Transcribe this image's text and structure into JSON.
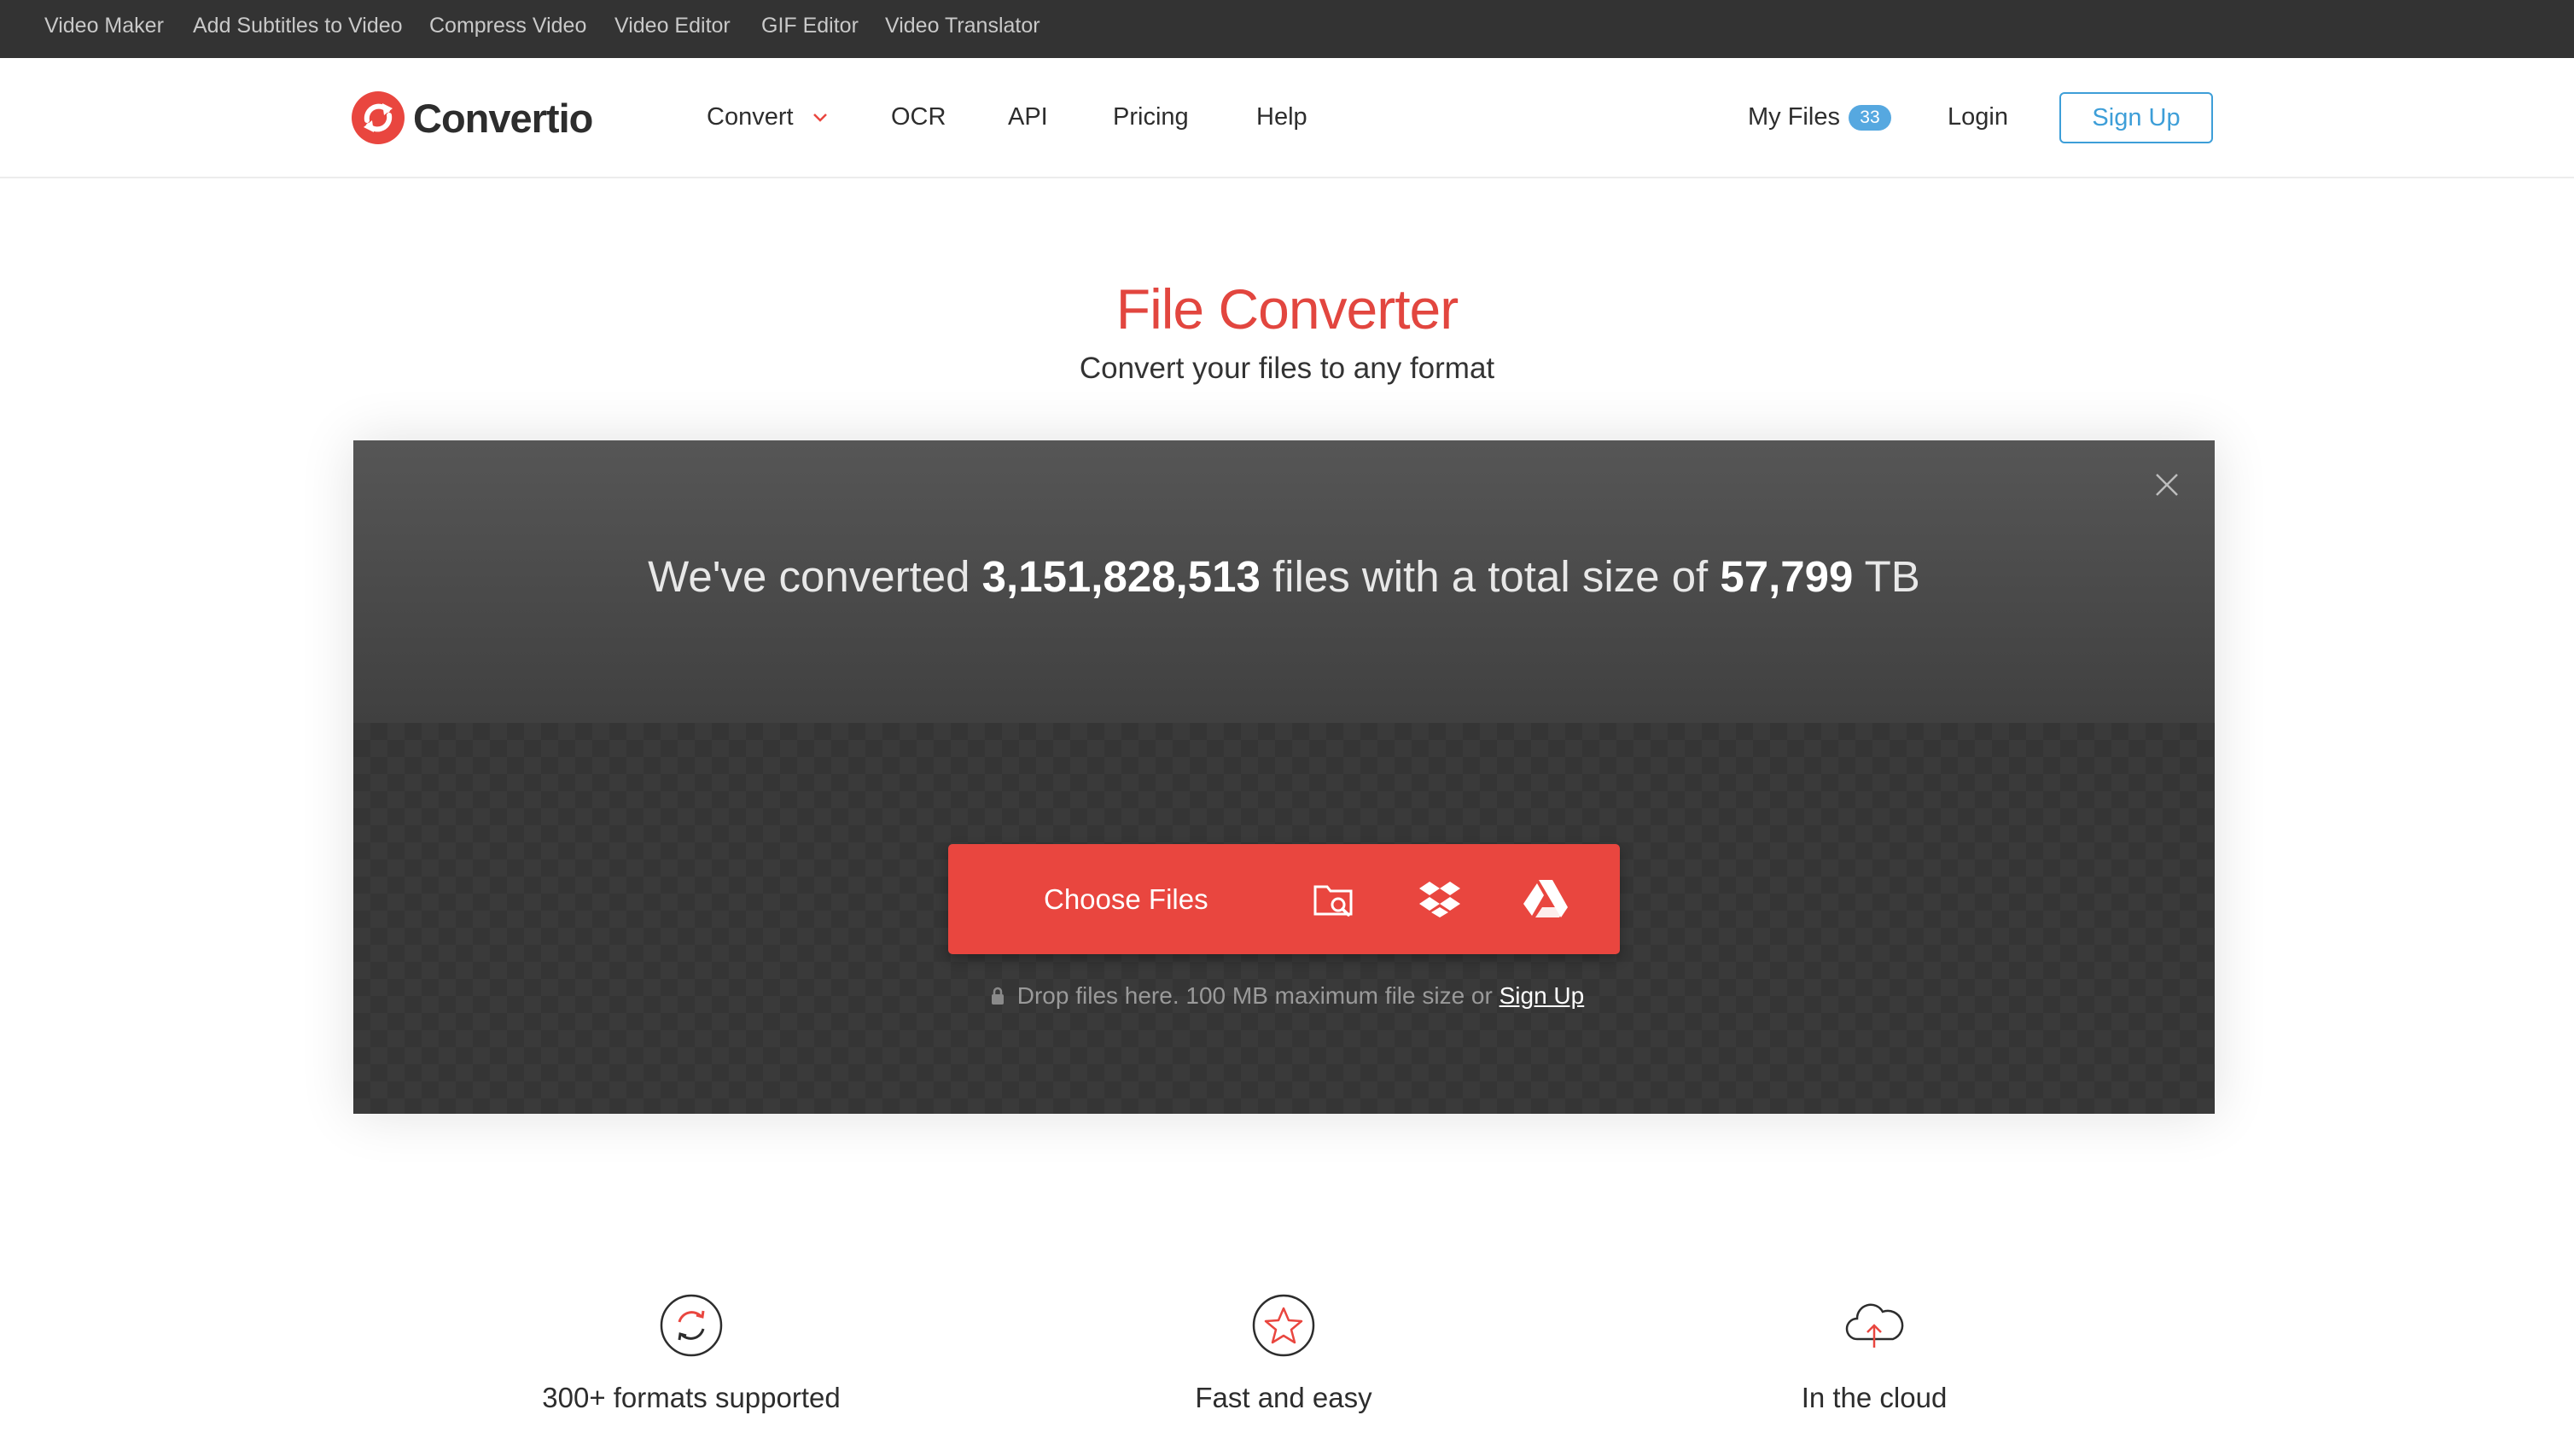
{
  "topbar": {
    "links": [
      "Video Maker",
      "Add Subtitles to Video",
      "Compress Video",
      "Video Editor",
      "GIF Editor",
      "Video Translator"
    ]
  },
  "header": {
    "logo_text": "Convertio",
    "nav": {
      "convert": "Convert",
      "ocr": "OCR",
      "api": "API",
      "pricing": "Pricing",
      "help": "Help"
    },
    "my_files_label": "My Files",
    "my_files_count": "33",
    "login_label": "Login",
    "signup_label": "Sign Up"
  },
  "hero": {
    "title": "File Converter",
    "subtitle": "Convert your files to any format"
  },
  "converter": {
    "stats_prefix": "We've converted",
    "files_count": "3,151,828,513",
    "stats_middle": "files with a total size of",
    "total_size": "57,799",
    "size_unit": "TB",
    "choose_label": "Choose Files",
    "sources": [
      "folder-search-icon",
      "dropbox-icon",
      "google-drive-icon"
    ],
    "drop_note": "Drop files here. 100 MB maximum file size or",
    "drop_link": "Sign Up"
  },
  "features": [
    {
      "icon": "refresh-icon",
      "title": "300+ formats supported"
    },
    {
      "icon": "star-icon",
      "title": "Fast and easy"
    },
    {
      "icon": "cloud-upload-icon",
      "title": "In the cloud"
    }
  ],
  "colors": {
    "brand_red": "#e9463f",
    "accent_blue": "#3d9ed8",
    "topbar_bg": "#333333"
  }
}
